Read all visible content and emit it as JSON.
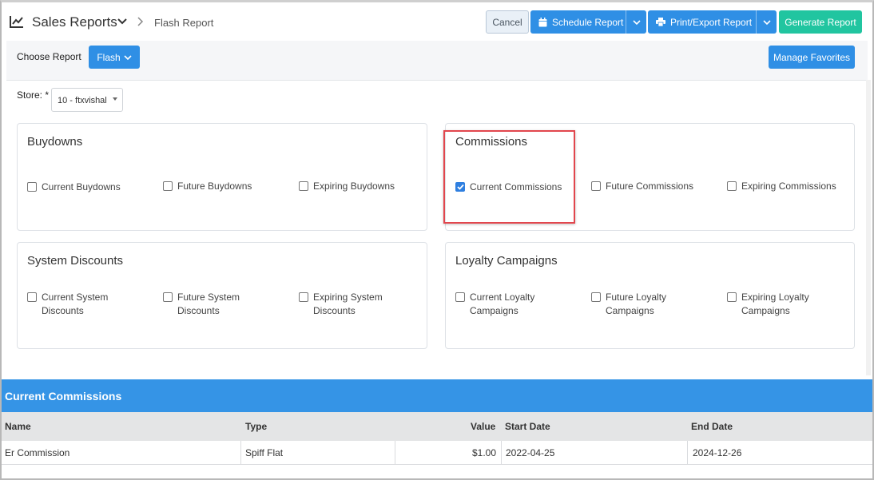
{
  "header": {
    "title": "Sales Reports",
    "breadcrumb": "Flash Report",
    "buttons": {
      "cancel": "Cancel",
      "schedule": "Schedule Report",
      "print": "Print/Export Report",
      "generate": "Generate Report"
    }
  },
  "report_bar": {
    "choose_label": "Choose Report",
    "flash_label": "Flash",
    "favorites_label": "Manage Favorites"
  },
  "store": {
    "label": "Store: *",
    "value": "10 - ftxvishal"
  },
  "cards": {
    "buydowns": {
      "title": "Buydowns",
      "options": [
        "Current Buydowns",
        "Future Buydowns",
        "Expiring Buydowns"
      ]
    },
    "commissions": {
      "title": "Commissions",
      "options": [
        "Current Commissions",
        "Future Commissions",
        "Expiring Commissions"
      ],
      "checked": "Current Commissions"
    },
    "system_discounts": {
      "title": "System Discounts",
      "options": [
        {
          "line1": "Current System",
          "line2": "Discounts"
        },
        {
          "line1": "Future System",
          "line2": "Discounts"
        },
        {
          "line1": "Expiring System",
          "line2": "Discounts"
        }
      ]
    },
    "loyalty": {
      "title": "Loyalty Campaigns",
      "options": [
        {
          "line1": "Current Loyalty",
          "line2": "Campaigns"
        },
        {
          "line1": "Future Loyalty",
          "line2": "Campaigns"
        },
        {
          "line1": "Expiring Loyalty",
          "line2": "Campaigns"
        }
      ]
    }
  },
  "table": {
    "title": "Current Commissions",
    "columns": [
      "Name",
      "Type",
      "Value",
      "Start Date",
      "End Date"
    ],
    "rows": [
      [
        "Er Commission",
        "Spiff Flat",
        "$1.00",
        "2022-04-25",
        "2024-12-26"
      ]
    ]
  },
  "colors": {
    "primary": "#2f8fe5",
    "success": "#21c5a0",
    "highlight": "#e2464d"
  }
}
